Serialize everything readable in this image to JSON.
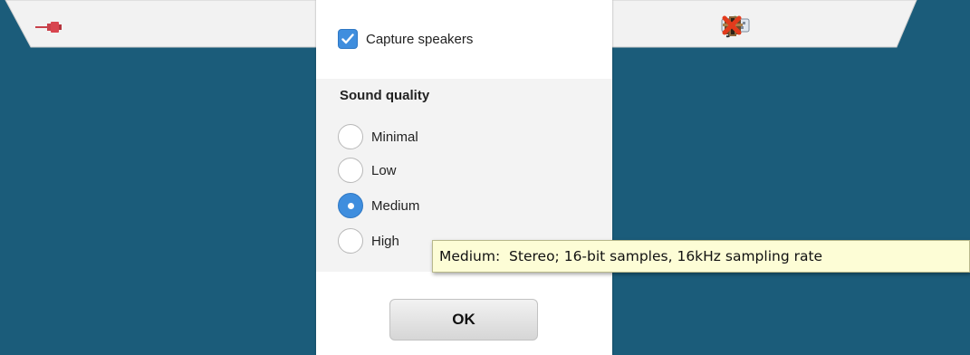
{
  "toolbar": {
    "left_icons": [
      "pin-icon"
    ],
    "right_icons": [
      "microphone-icon",
      "speaker-icon",
      "keyboard-icon",
      "camera-icon",
      "close-icon"
    ],
    "close_color": "#e23b1c"
  },
  "dialog": {
    "capture_speakers": {
      "label": "Capture speakers",
      "checked": true
    },
    "sound_quality": {
      "title": "Sound quality",
      "options": [
        {
          "label": "Minimal",
          "selected": false
        },
        {
          "label": "Low",
          "selected": false
        },
        {
          "label": "Medium",
          "selected": true
        },
        {
          "label": "High",
          "selected": false
        }
      ]
    },
    "ok_label": "OK"
  },
  "tooltip": {
    "text": "Medium:  Stereo; 16-bit samples, 16kHz sampling rate"
  },
  "colors": {
    "background": "#1b5c7a",
    "accent": "#3f8ede",
    "tooltip_bg": "#fdfdd6"
  }
}
